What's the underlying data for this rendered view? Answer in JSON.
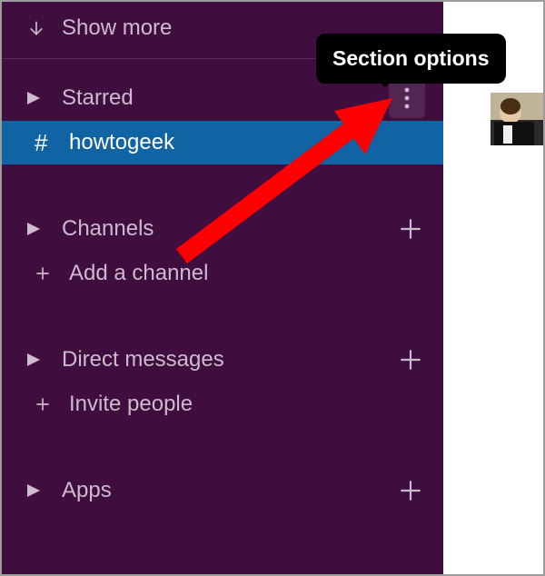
{
  "show_more": "Show more",
  "tooltip": "Section options",
  "sections": {
    "starred": {
      "label": "Starred",
      "channel": "howtogeek"
    },
    "channels": {
      "label": "Channels",
      "add": "Add a channel"
    },
    "dms": {
      "label": "Direct messages",
      "invite": "Invite people"
    },
    "apps": {
      "label": "Apps"
    }
  }
}
